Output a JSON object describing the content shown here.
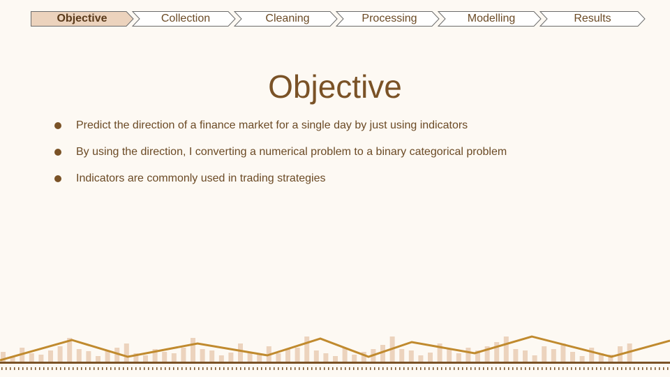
{
  "nav": {
    "steps": [
      "Objective",
      "Collection",
      "Cleaning",
      "Processing",
      "Modelling",
      "Results"
    ],
    "active_index": 0
  },
  "slide": {
    "title": "Objective",
    "bullets": [
      "Predict the direction of a finance market for a single day by just using indicators",
      "By using the direction, I converting a numerical problem to a binary categorical problem",
      "Indicators are commonly used in trading strategies"
    ]
  },
  "colors": {
    "background": "#fdf9f3",
    "accent": "#c08a2e",
    "text": "#6b4a25",
    "title": "#7a5226",
    "active_tab_fill": "#ecd3bd",
    "bar_fill": "#ecd3bd"
  }
}
